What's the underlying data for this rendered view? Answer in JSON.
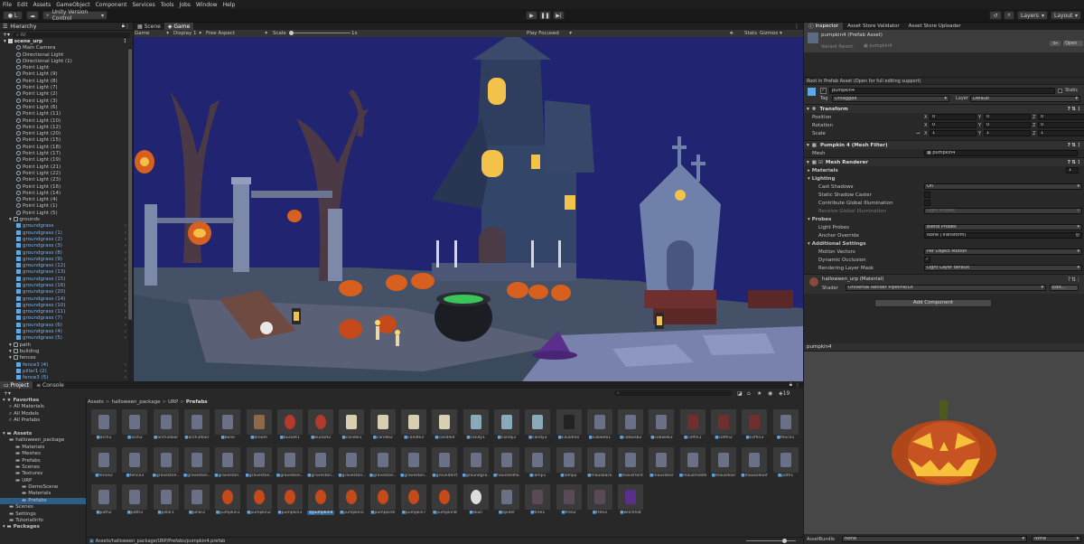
{
  "menu": [
    "File",
    "Edit",
    "Assets",
    "GameObject",
    "Component",
    "Services",
    "Tools",
    "Jobs",
    "Window",
    "Help"
  ],
  "toolbar": {
    "account": "L",
    "vcs": "Unity Version Control",
    "layers": "Layers",
    "layout": "Layout"
  },
  "hierarchy": {
    "tab": "Hierarchy",
    "search": "All",
    "scene": "scene_urp",
    "items": [
      {
        "t": "Main Camera",
        "i": 2,
        "k": "go"
      },
      {
        "t": "Directional Light",
        "i": 2,
        "k": "go"
      },
      {
        "t": "Directional Light (1)",
        "i": 2,
        "k": "go"
      },
      {
        "t": "Point Light",
        "i": 2,
        "k": "go"
      },
      {
        "t": "Point Light (9)",
        "i": 2,
        "k": "go"
      },
      {
        "t": "Point Light (8)",
        "i": 2,
        "k": "go"
      },
      {
        "t": "Point Light (7)",
        "i": 2,
        "k": "go"
      },
      {
        "t": "Point Light (2)",
        "i": 2,
        "k": "go"
      },
      {
        "t": "Point Light (3)",
        "i": 2,
        "k": "go"
      },
      {
        "t": "Point Light (6)",
        "i": 2,
        "k": "go"
      },
      {
        "t": "Point Light (11)",
        "i": 2,
        "k": "go"
      },
      {
        "t": "Point Light (10)",
        "i": 2,
        "k": "go"
      },
      {
        "t": "Point Light (12)",
        "i": 2,
        "k": "go"
      },
      {
        "t": "Point Light (20)",
        "i": 2,
        "k": "go"
      },
      {
        "t": "Point Light (15)",
        "i": 2,
        "k": "go"
      },
      {
        "t": "Point Light (18)",
        "i": 2,
        "k": "go"
      },
      {
        "t": "Point Light (17)",
        "i": 2,
        "k": "go"
      },
      {
        "t": "Point Light (19)",
        "i": 2,
        "k": "go"
      },
      {
        "t": "Point Light (21)",
        "i": 2,
        "k": "go"
      },
      {
        "t": "Point Light (22)",
        "i": 2,
        "k": "go"
      },
      {
        "t": "Point Light (23)",
        "i": 2,
        "k": "go"
      },
      {
        "t": "Point Light (16)",
        "i": 2,
        "k": "go"
      },
      {
        "t": "Point Light (14)",
        "i": 2,
        "k": "go"
      },
      {
        "t": "Point Light (4)",
        "i": 2,
        "k": "go"
      },
      {
        "t": "Point Light (1)",
        "i": 2,
        "k": "go"
      },
      {
        "t": "Point Light (5)",
        "i": 2,
        "k": "go"
      },
      {
        "t": "grounds",
        "i": 1,
        "k": "fold"
      },
      {
        "t": "groundgrass",
        "i": 2,
        "k": "pf"
      },
      {
        "t": "groundgrass (1)",
        "i": 2,
        "k": "pf"
      },
      {
        "t": "groundgrass (2)",
        "i": 2,
        "k": "pf"
      },
      {
        "t": "groundgrass (3)",
        "i": 2,
        "k": "pf"
      },
      {
        "t": "groundgrass (8)",
        "i": 2,
        "k": "pf"
      },
      {
        "t": "groundgrass (9)",
        "i": 2,
        "k": "pf"
      },
      {
        "t": "groundgrass (12)",
        "i": 2,
        "k": "pf"
      },
      {
        "t": "groundgrass (13)",
        "i": 2,
        "k": "pf"
      },
      {
        "t": "groundgrass (15)",
        "i": 2,
        "k": "pf"
      },
      {
        "t": "groundgrass (16)",
        "i": 2,
        "k": "pf"
      },
      {
        "t": "groundgrass (20)",
        "i": 2,
        "k": "pf"
      },
      {
        "t": "groundgrass (14)",
        "i": 2,
        "k": "pf"
      },
      {
        "t": "groundgrass (10)",
        "i": 2,
        "k": "pf"
      },
      {
        "t": "groundgrass (11)",
        "i": 2,
        "k": "pf"
      },
      {
        "t": "groundgrass (7)",
        "i": 2,
        "k": "pf"
      },
      {
        "t": "groundgrass (6)",
        "i": 2,
        "k": "pf"
      },
      {
        "t": "groundgrass (4)",
        "i": 2,
        "k": "pf"
      },
      {
        "t": "groundgrass (5)",
        "i": 2,
        "k": "pf"
      },
      {
        "t": "path",
        "i": 1,
        "k": "fold"
      },
      {
        "t": "building",
        "i": 1,
        "k": "fold"
      },
      {
        "t": "fences",
        "i": 1,
        "k": "fold"
      },
      {
        "t": "fence3 (4)",
        "i": 2,
        "k": "pf"
      },
      {
        "t": "pillar1 (2)",
        "i": 2,
        "k": "pf"
      },
      {
        "t": "fence3 (5)",
        "i": 2,
        "k": "pf"
      }
    ]
  },
  "scene": {
    "tab_scene": "Scene",
    "tab_game": "Game",
    "game": "Game",
    "display": "Display 1",
    "aspect": "Free Aspect",
    "scale_label": "Scale",
    "scale_value": "1x",
    "play_focused": "Play Focused",
    "stats": "Stats",
    "gizmos": "Gizmos"
  },
  "project": {
    "tab_project": "Project",
    "tab_console": "Console",
    "count": "19",
    "breadcrumb": [
      "Assets",
      "halloween_package",
      "URP",
      "Prefabs"
    ],
    "tree": [
      {
        "t": "Favorites",
        "i": 0,
        "b": true
      },
      {
        "t": "All Materials",
        "i": 1
      },
      {
        "t": "All Models",
        "i": 1
      },
      {
        "t": "All Prefabs",
        "i": 1
      },
      {
        "t": "",
        "i": 0
      },
      {
        "t": "Assets",
        "i": 0,
        "b": true
      },
      {
        "t": "halloween_package",
        "i": 1
      },
      {
        "t": "Materials",
        "i": 2
      },
      {
        "t": "Meshes",
        "i": 2
      },
      {
        "t": "Prefabs",
        "i": 2
      },
      {
        "t": "Scenes",
        "i": 2
      },
      {
        "t": "Textures",
        "i": 2
      },
      {
        "t": "URP",
        "i": 2
      },
      {
        "t": "DemoScene",
        "i": 3
      },
      {
        "t": "Materials",
        "i": 3
      },
      {
        "t": "Prefabs",
        "i": 3,
        "s": true
      },
      {
        "t": "Scenes",
        "i": 1
      },
      {
        "t": "Settings",
        "i": 1
      },
      {
        "t": "TutorialInfo",
        "i": 1
      },
      {
        "t": "Packages",
        "i": 0,
        "b": true
      }
    ],
    "assets": [
      "arch1",
      "arch2",
      "arch3door",
      "arch3door",
      "bone",
      "broom",
      "bucket1",
      "bucket2",
      "candle1",
      "candle2",
      "candle3",
      "candle4",
      "candy1",
      "candy2",
      "candy3",
      "cauldron",
      "cobweb1",
      "cobweb2",
      "cobweb3",
      "coffin1",
      "coffin2",
      "coffin3",
      "fence1",
      "fence2",
      "fence3",
      "graveston...",
      "graveston...",
      "graveston...",
      "graveston...",
      "graveston...",
      "graveston...",
      "graveston...",
      "graveston...",
      "graveston...",
      "grounddirt",
      "groundgra...",
      "hauntedho...",
      "lamp1",
      "lamp2",
      "mausback",
      "mausfront",
      "mausdoor",
      "mausmiddle",
      "mausdoor",
      "mausoleum",
      "path1",
      "path2",
      "path3",
      "pillar1",
      "pillar2",
      "pumpkin1",
      "pumpkin2",
      "pumpkin3",
      "pumpkin4",
      "pumpkin5",
      "pumpkin6",
      "pumpkin7",
      "pumpkin8",
      "skull",
      "spider",
      "tree1",
      "tree2",
      "tree3",
      "witchhat"
    ],
    "selected_asset": "pumpkin4",
    "footer_path": "Assets/halloween_package/URP/Prefabs/pumpkin4.prefab"
  },
  "inspector": {
    "tabs": [
      "Inspector",
      "Asset Store Validator",
      "Asset Store Uploader"
    ],
    "asset_title": "pumpkin4 (Prefab Asset)",
    "open": "Open",
    "variant_label": "Variant Parent",
    "variant_value": "pumpkin4",
    "root_note": "Root in Prefab Asset (Open for full editing support)",
    "name": "pumpkin4",
    "static": "Static",
    "tag_label": "Tag",
    "tag_value": "Untagged",
    "layer_label": "Layer",
    "layer_value": "Default",
    "transform": {
      "title": "Transform",
      "position": "Position",
      "rotation": "Rotation",
      "scale": "Scale",
      "pos": [
        "0",
        "0",
        "0"
      ],
      "rot": [
        "0",
        "0",
        "0"
      ],
      "scl": [
        "1",
        "1",
        "1"
      ]
    },
    "mesh_filter": {
      "title": "Pumpkin 4 (Mesh Filter)",
      "mesh_label": "Mesh",
      "mesh_value": "pumpkin4"
    },
    "mesh_renderer": {
      "title": "Mesh Renderer",
      "materials": "Materials",
      "materials_count": "1",
      "lighting": "Lighting",
      "cast_shadows": "Cast Shadows",
      "cast_shadows_value": "On",
      "static_shadow": "Static Shadow Caster",
      "contribute_gi": "Contribute Global Illumination",
      "receive_gi": "Receive Global Illumination",
      "receive_gi_value": "Light Probes",
      "probes": "Probes",
      "light_probes": "Light Probes",
      "light_probes_value": "Blend Probes",
      "anchor": "Anchor Override",
      "anchor_value": "None (Transform)",
      "additional": "Additional Settings",
      "motion": "Motion Vectors",
      "motion_value": "Per Object Motion",
      "dynamic_occ": "Dynamic Occlusion",
      "rendering_layer": "Rendering Layer Mask",
      "rendering_layer_value": "Light Layer default"
    },
    "material": {
      "title": "halloween_urp (Material)",
      "shader_label": "Shader",
      "shader_value": "Universal Render Pipeline/Lit",
      "edit": "Edit..."
    },
    "add_component": "Add Component",
    "preview_title": "pumpkin4",
    "assetbundle_label": "AssetBundle",
    "assetbundle_value": "None",
    "assetbundle_variant": "None"
  },
  "colors": {
    "sky": "#212470",
    "ground": "#4a5a74",
    "selection": "#2c5d87",
    "link_blue": "#7ab4ef"
  }
}
